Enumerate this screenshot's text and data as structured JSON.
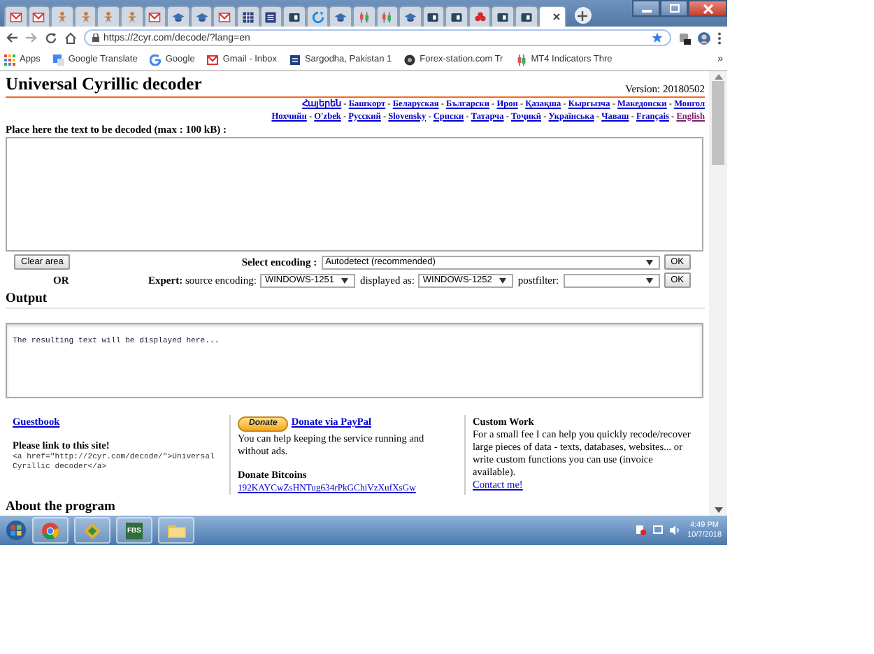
{
  "browser": {
    "tabs": [
      {
        "selected": false
      },
      {
        "selected": false
      },
      {
        "selected": false
      },
      {
        "selected": false
      },
      {
        "selected": false
      },
      {
        "selected": false
      },
      {
        "selected": false
      },
      {
        "selected": false
      },
      {
        "selected": false
      },
      {
        "selected": false
      },
      {
        "selected": false
      },
      {
        "selected": false
      },
      {
        "selected": false
      },
      {
        "selected": false
      },
      {
        "selected": false
      },
      {
        "selected": false
      },
      {
        "selected": false
      },
      {
        "selected": false
      },
      {
        "selected": false
      },
      {
        "selected": false
      },
      {
        "selected": false
      },
      {
        "selected": false
      },
      {
        "selected": false
      },
      {
        "selected": true
      }
    ],
    "url": "https://2cyr.com/decode/?lang=en",
    "bookmarks": [
      "Apps",
      "Google Translate",
      "Google",
      "Gmail - Inbox",
      "Sargodha, Pakistan 1",
      "Forex-station.com Tr",
      "MT4 Indicators Thre"
    ],
    "bookmarks_more": "»"
  },
  "page": {
    "title": "Universal Cyrillic decoder",
    "version": "Version: 20180502",
    "languages": [
      [
        {
          "label": "Հայերեն",
          "selected": false
        },
        {
          "label": "Башҡорт",
          "selected": false
        },
        {
          "label": "Беларуская",
          "selected": false
        },
        {
          "label": "Български",
          "selected": false
        },
        {
          "label": "Ирон",
          "selected": false
        },
        {
          "label": "Қазақша",
          "selected": false
        },
        {
          "label": "Кыргызча",
          "selected": false
        },
        {
          "label": "Македонски",
          "selected": false
        },
        {
          "label": "Монгол",
          "selected": false
        }
      ],
      [
        {
          "label": "Нохчийн",
          "selected": false
        },
        {
          "label": "O'zbek",
          "selected": false
        },
        {
          "label": "Русский",
          "selected": false
        },
        {
          "label": "Slovensky",
          "selected": false
        },
        {
          "label": "Српски",
          "selected": false
        },
        {
          "label": "Татарча",
          "selected": false
        },
        {
          "label": "Тоҷикӣ",
          "selected": false
        },
        {
          "label": "Українська",
          "selected": false
        },
        {
          "label": "Чаваш",
          "selected": false
        },
        {
          "label": "Français",
          "selected": false
        },
        {
          "label": "English",
          "selected": true
        }
      ]
    ],
    "language_separator": "-",
    "input_label": "Place here the text to be decoded (max : 100 kB) :",
    "clear_button": "Clear area",
    "select_encoding_label": "Select encoding :",
    "encoding_value": "Autodetect (recommended)",
    "ok_button": "OK",
    "or_label": "OR",
    "expert_label": "**Expert:** source encoding:",
    "source_encoding": "WINDOWS-1251",
    "displayed_as_label": "displayed as:",
    "displayed_as": "WINDOWS-1252",
    "postfilter_label": "postfilter:",
    "expert_ok_button": "OK",
    "output_heading": "Output",
    "output_text": "The resulting text will be displayed here...",
    "footer": {
      "guestbook": "Guestbook",
      "link_heading": "Please link to this site!",
      "link_code": "<a href=\"http://2cyr.com/decode/\">Universal Cyrillic decoder</a>",
      "donate_button": "Donate",
      "paypal_link": "Donate via PayPal",
      "donate_text": "You can help keeping the service running and without ads.",
      "bitcoin_heading": "Donate Bitcoins",
      "bitcoin_address": "192KAYCwZsHNTug634rPkGChiVzXufXsGw",
      "custom_heading": "Custom Work",
      "custom_text": "For a small fee I can help you quickly recode/recover large pieces of data - texts, databases, websites... or write custom functions you can use (invoice available).",
      "contact_link": "Contact me!"
    },
    "about_heading": "About the program"
  },
  "taskbar": {
    "app_label": "FBS",
    "time": "4:49 PM",
    "date": "10/7/2018"
  }
}
